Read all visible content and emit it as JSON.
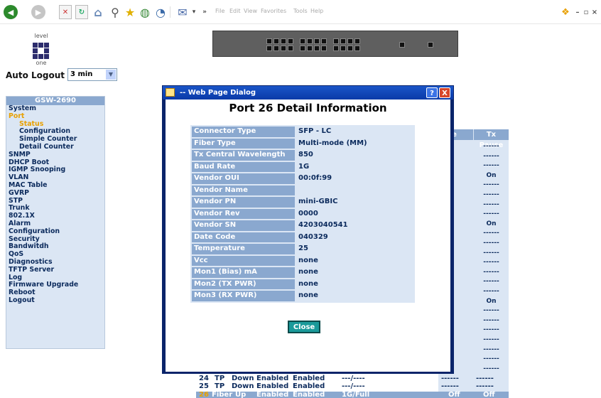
{
  "toolbar": {
    "menu": [
      "File",
      "Edit",
      "View",
      "Favorites",
      "Tools",
      "Help"
    ]
  },
  "logo": {
    "top_text": "level",
    "bottom_text": "one"
  },
  "auto_logout": {
    "label": "Auto Logout",
    "value": "3 min"
  },
  "sidebar": {
    "title": "GSW-2690",
    "items": [
      {
        "label": "System",
        "sub": false
      },
      {
        "label": "Port",
        "sub": false,
        "active": true
      },
      {
        "label": "Status",
        "sub": true,
        "active": true
      },
      {
        "label": "Configuration",
        "sub": true
      },
      {
        "label": "Simple Counter",
        "sub": true
      },
      {
        "label": "Detail Counter",
        "sub": true
      },
      {
        "label": "SNMP",
        "sub": false
      },
      {
        "label": "DHCP Boot",
        "sub": false
      },
      {
        "label": "IGMP Snooping",
        "sub": false
      },
      {
        "label": "VLAN",
        "sub": false
      },
      {
        "label": "MAC Table",
        "sub": false
      },
      {
        "label": "GVRP",
        "sub": false
      },
      {
        "label": "STP",
        "sub": false
      },
      {
        "label": "Trunk",
        "sub": false
      },
      {
        "label": "802.1X",
        "sub": false
      },
      {
        "label": "Alarm",
        "sub": false
      },
      {
        "label": "Configuration",
        "sub": false
      },
      {
        "label": "Security",
        "sub": false
      },
      {
        "label": "Bandwitdh",
        "sub": false
      },
      {
        "label": "QoS",
        "sub": false
      },
      {
        "label": "Diagnostics",
        "sub": false
      },
      {
        "label": "TFTP Server",
        "sub": false
      },
      {
        "label": "Log",
        "sub": false
      },
      {
        "label": "Firmware Upgrade",
        "sub": false
      },
      {
        "label": "Reboot",
        "sub": false
      },
      {
        "label": "Logout",
        "sub": false
      }
    ]
  },
  "bg_table": {
    "rx_pause_header": "use",
    "tx_pause_header": "Tx Pause",
    "rx_col": [
      "--",
      "--",
      "--",
      "--",
      "--",
      "--",
      "--",
      "--",
      "--",
      "--",
      "--",
      "--",
      "--",
      "--",
      "--",
      "--",
      "--",
      "--",
      "--",
      "--",
      "--",
      "--",
      "--",
      "--"
    ],
    "tx_col": [
      "------",
      "------",
      "------",
      "On",
      "------",
      "------",
      "------",
      "------",
      "On",
      "------",
      "------",
      "------",
      "------",
      "------",
      "------",
      "------",
      "On",
      "------",
      "------",
      "------",
      "------",
      "------",
      "------",
      "------"
    ],
    "row24": [
      "24",
      "TP",
      "Down",
      "Enabled",
      "Enabled",
      "---/----",
      "------",
      "------"
    ],
    "row25": [
      "25",
      "TP",
      "Down",
      "Enabled",
      "Enabled",
      "---/----",
      "------",
      "------"
    ],
    "row26": [
      "26",
      "Fiber",
      "Up",
      "Enabled",
      "Enabled",
      "1G/Full",
      "Off",
      "Off"
    ]
  },
  "dialog": {
    "title": "-- Web Page Dialog",
    "help": "?",
    "close": "X",
    "heading": "Port 26 Detail Information",
    "rows": [
      {
        "label": "Connector Type",
        "value": "SFP - LC"
      },
      {
        "label": "Fiber Type",
        "value": "Multi-mode (MM)"
      },
      {
        "label": "Tx Central Wavelength",
        "value": "850"
      },
      {
        "label": "Baud Rate",
        "value": "1G"
      },
      {
        "label": "Vendor OUI",
        "value": "00:0f:99"
      },
      {
        "label": "Vendor Name",
        "value": ""
      },
      {
        "label": "Vendor PN",
        "value": "mini-GBIC"
      },
      {
        "label": "Vendor Rev",
        "value": "0000"
      },
      {
        "label": "Vendor SN",
        "value": "4203040541"
      },
      {
        "label": "Date Code",
        "value": "040329"
      },
      {
        "label": "Temperature",
        "value": "25"
      },
      {
        "label": "Vcc",
        "value": "none"
      },
      {
        "label": "Mon1 (Bias) mA",
        "value": "none"
      },
      {
        "label": "Mon2 (TX PWR)",
        "value": "none"
      },
      {
        "label": "Mon3 (RX PWR)",
        "value": "none"
      }
    ],
    "close_button": "Close"
  }
}
